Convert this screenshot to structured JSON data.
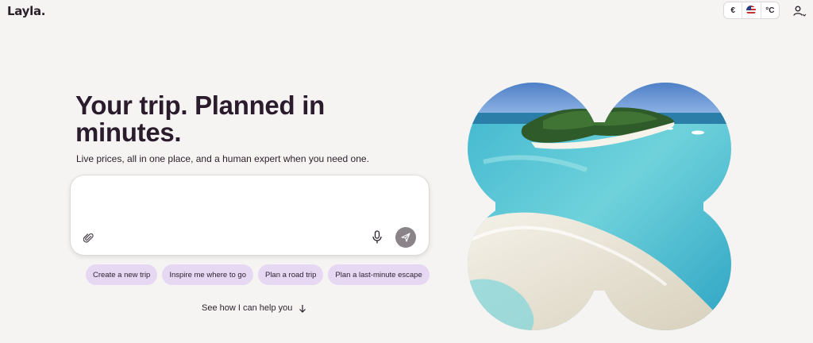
{
  "header": {
    "logo": "Layla.",
    "currency": "€",
    "temperature_unit": "°C",
    "flag_icon": "us-flag-icon",
    "account_icon": "user-icon"
  },
  "hero": {
    "title": "Your trip. Planned in minutes.",
    "subtitle": "Live prices, all in one place, and a human expert when you need one."
  },
  "chat": {
    "placeholder": "",
    "attach_icon": "paperclip-icon",
    "mic_icon": "microphone-icon",
    "send_icon": "send-icon"
  },
  "suggestions": [
    "Create a new trip",
    "Inspire me where to go",
    "Plan a road trip",
    "Plan a last-minute escape"
  ],
  "see_how": "See how I can help you",
  "colors": {
    "background": "#f6f4f2",
    "chip": "#e6d8f3",
    "text": "#2a1f2b",
    "send_button": "#8a8388"
  }
}
